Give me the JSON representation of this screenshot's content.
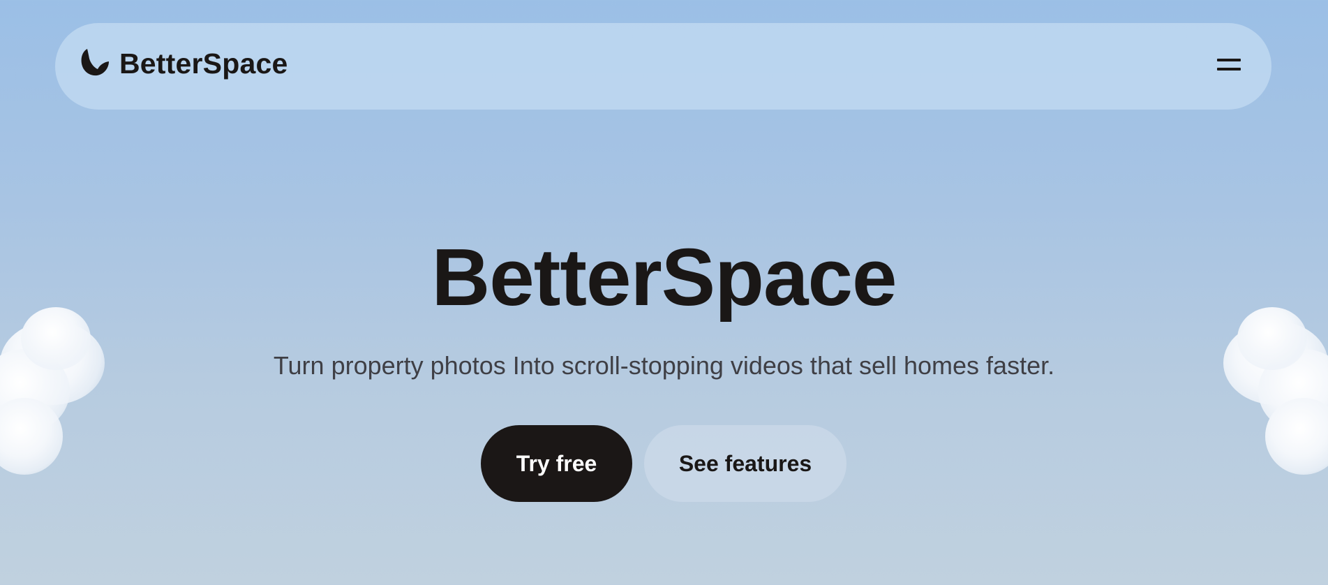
{
  "navbar": {
    "brand_name": "BetterSpace",
    "logo_icon": "leaf-logo-icon",
    "menu_icon": "hamburger-menu-icon"
  },
  "hero": {
    "title": "BetterSpace",
    "subtitle": "Turn property photos Into scroll-stopping videos that sell homes faster.",
    "primary_button": "Try free",
    "secondary_button": "See features"
  },
  "colors": {
    "sky_top": "#9bbfe6",
    "sky_bottom": "#c0d1df",
    "ink": "#1a1716",
    "subtitle": "#3f3f45"
  }
}
